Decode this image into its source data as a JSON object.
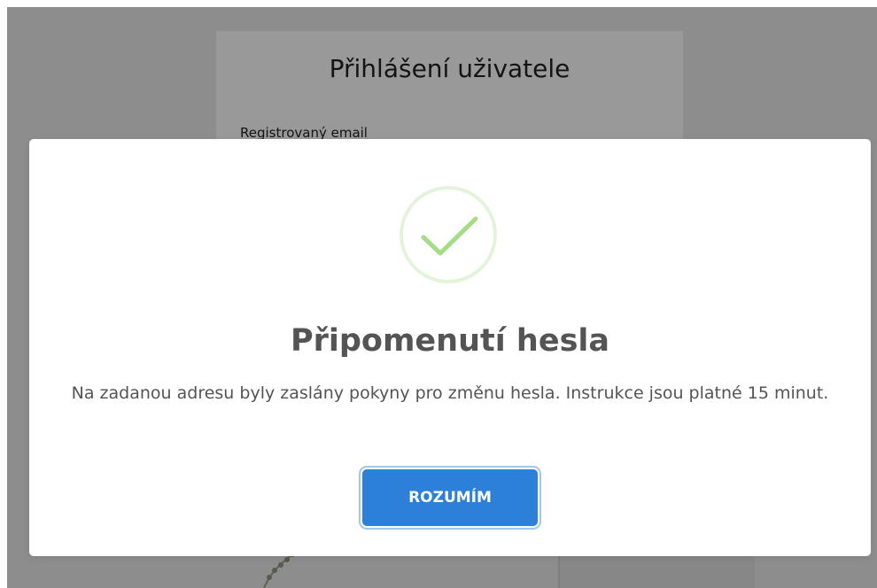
{
  "background_page": {
    "login_title": "Přihlášení uživatele",
    "email_label": "Registrovaný email"
  },
  "modal": {
    "icon": "success-check-icon",
    "title": "Připomenutí hesla",
    "message": "Na zadanou adresu byly zaslány pokyny pro změnu hesla. Instrukce jsou platné 15 minut.",
    "confirm_label": "ROZUMÍM",
    "colors": {
      "accent": "#2c80d8",
      "success": "#a5dc86",
      "text": "#545454"
    }
  }
}
